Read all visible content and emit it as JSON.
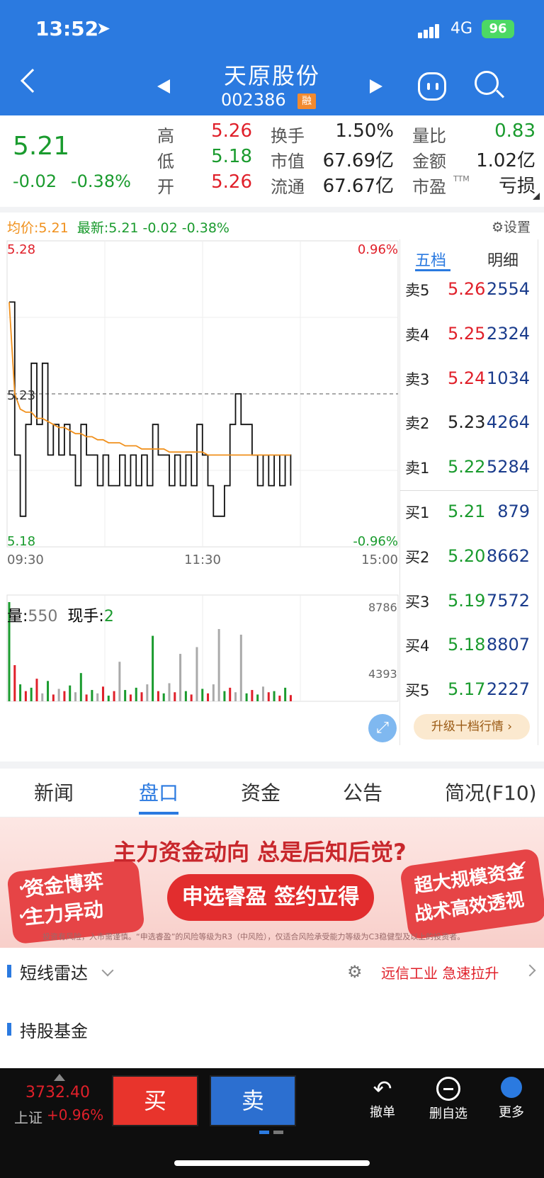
{
  "status_bar": {
    "time": "13:52",
    "network": "4G",
    "battery": "96"
  },
  "header": {
    "name": "天原股份",
    "code": "002386",
    "badge": "融"
  },
  "quote": {
    "price": "5.21",
    "change": "-0.02",
    "change_pct": "-0.38%",
    "stats": [
      {
        "label": "高",
        "value": "5.26",
        "color": "#e0202a"
      },
      {
        "label": "低",
        "value": "5.18",
        "color": "#1a9b2e"
      },
      {
        "label": "开",
        "value": "5.26",
        "color": "#e0202a"
      },
      {
        "label": "换手",
        "value": "1.50%",
        "color": "#222222"
      },
      {
        "label": "市值",
        "value": "67.69亿",
        "color": "#222222"
      },
      {
        "label": "流通",
        "value": "67.67亿",
        "color": "#222222"
      },
      {
        "label": "量比",
        "value": "0.83",
        "color": "#1a9b2e"
      },
      {
        "label": "金额",
        "value": "1.02亿",
        "color": "#222222"
      },
      {
        "label": "市盈",
        "value": "亏损",
        "color": "#222222"
      }
    ],
    "pe_sup": "TTM"
  },
  "intraday": {
    "avg_label": "均价:5.21",
    "latest_label": "最新:5.21 -0.02 -0.38%",
    "settings": "设置",
    "y_high": "5.28",
    "y_low": "5.18",
    "y_mid": "5.23",
    "pct_high": "0.96%",
    "pct_low": "-0.96%",
    "times": [
      "09:30",
      "11:30",
      "15:00"
    ],
    "vol_label": "量:",
    "vol_value": "550",
    "hand_label": "现手:",
    "hand_value": "2",
    "vol_max": "8786",
    "vol_mid": "4393"
  },
  "chart_data": {
    "type": "line",
    "price_range": [
      5.18,
      5.28
    ],
    "prev_close": 5.23,
    "price": [
      5.26,
      5.21,
      5.19,
      5.22,
      5.24,
      5.22,
      5.24,
      5.21,
      5.22,
      5.21,
      5.22,
      5.21,
      5.2,
      5.22,
      5.21,
      5.21,
      5.2,
      5.21,
      5.2,
      5.2,
      5.21,
      5.2,
      5.21,
      5.2,
      5.21,
      5.2,
      5.22,
      5.21,
      5.21,
      5.2,
      5.21,
      5.2,
      5.21,
      5.2,
      5.22,
      5.21,
      5.2,
      5.19,
      5.19,
      5.2,
      5.22,
      5.23,
      5.22,
      5.22,
      5.21,
      5.2,
      5.21,
      5.2,
      5.21,
      5.2,
      5.21,
      5.2
    ],
    "avg": [
      5.26,
      5.23,
      5.225,
      5.224,
      5.224,
      5.222,
      5.222,
      5.221,
      5.22,
      5.219,
      5.219,
      5.218,
      5.217,
      5.217,
      5.216,
      5.216,
      5.215,
      5.215,
      5.214,
      5.214,
      5.214,
      5.213,
      5.213,
      5.213,
      5.212,
      5.212,
      5.212,
      5.212,
      5.212,
      5.211,
      5.211,
      5.211,
      5.211,
      5.211,
      5.211,
      5.211,
      5.21,
      5.21,
      5.21,
      5.21,
      5.21,
      5.21,
      5.21,
      5.21,
      5.21,
      5.21,
      5.21,
      5.21,
      5.21,
      5.21,
      5.21,
      5.21
    ],
    "volume_max": 8786,
    "volume": [
      8786,
      3200,
      1500,
      900,
      1200,
      2000,
      700,
      1800,
      600,
      1100,
      900,
      1400,
      800,
      2500,
      600,
      1000,
      700,
      1300,
      500,
      900,
      3500,
      1000,
      600,
      1200,
      800,
      1500,
      5800,
      900,
      700,
      1600,
      800,
      4200,
      900,
      600,
      4800,
      1100,
      700,
      1500,
      6400,
      900,
      1200,
      800,
      5900,
      700,
      1000,
      600,
      1300,
      800,
      900,
      500,
      1200,
      550
    ],
    "volume_colors": [
      "g",
      "r",
      "g",
      "r",
      "g",
      "r",
      "gr",
      "g",
      "r",
      "gr",
      "r",
      "g",
      "gr",
      "g",
      "r",
      "g",
      "gr",
      "r",
      "g",
      "r",
      "gr",
      "g",
      "r",
      "g",
      "r",
      "gr",
      "g",
      "r",
      "g",
      "gr",
      "r",
      "gr",
      "g",
      "r",
      "gr",
      "g",
      "r",
      "gr",
      "gr",
      "g",
      "r",
      "gr",
      "gr",
      "g",
      "r",
      "g",
      "gr",
      "r",
      "g",
      "r",
      "g",
      "r"
    ]
  },
  "orderbook": {
    "tabs": [
      "五档",
      "明细"
    ],
    "sell": [
      {
        "label": "卖5",
        "price": "5.26",
        "vol": "2554",
        "color": "#e0202a"
      },
      {
        "label": "卖4",
        "price": "5.25",
        "vol": "2324",
        "color": "#e0202a"
      },
      {
        "label": "卖3",
        "price": "5.24",
        "vol": "1034",
        "color": "#e0202a"
      },
      {
        "label": "卖2",
        "price": "5.23",
        "vol": "4264",
        "color": "#222222"
      },
      {
        "label": "卖1",
        "price": "5.22",
        "vol": "5284",
        "color": "#1a9b2e"
      }
    ],
    "buy": [
      {
        "label": "买1",
        "price": "5.21",
        "vol": "879",
        "color": "#1a9b2e"
      },
      {
        "label": "买2",
        "price": "5.20",
        "vol": "8662",
        "color": "#1a9b2e"
      },
      {
        "label": "买3",
        "price": "5.19",
        "vol": "7572",
        "color": "#1a9b2e"
      },
      {
        "label": "买4",
        "price": "5.18",
        "vol": "8807",
        "color": "#1a9b2e"
      },
      {
        "label": "买5",
        "price": "5.17",
        "vol": "2227",
        "color": "#1a9b2e"
      }
    ],
    "upgrade": "升级十档行情 ›"
  },
  "tabs": [
    "新闻",
    "盘口",
    "资金",
    "公告",
    "简况(F10)"
  ],
  "banner": {
    "title": "主力资金动向 总是后知后觉?",
    "pill": "申选睿盈 签约立得",
    "left1": "资金博弈",
    "left2": "主力异动",
    "right1": "超大规模资金",
    "right2": "战术高效透视",
    "note": "投资有风险，入市需谨慎。“申选睿盈”的风险等级为R3（中风险），仅适合风险承受能力等级为C3稳健型及以上的投资者。"
  },
  "sections": {
    "radar": "短线雷达",
    "radar_alert": "远信工业 急速拉升",
    "funds": "持股基金"
  },
  "bottom": {
    "index_value": "3732.40",
    "index_name": "上证",
    "index_pct": "+0.96%",
    "buy": "买",
    "sell": "卖",
    "undo": "撤单",
    "remove": "删自选",
    "more": "更多"
  }
}
